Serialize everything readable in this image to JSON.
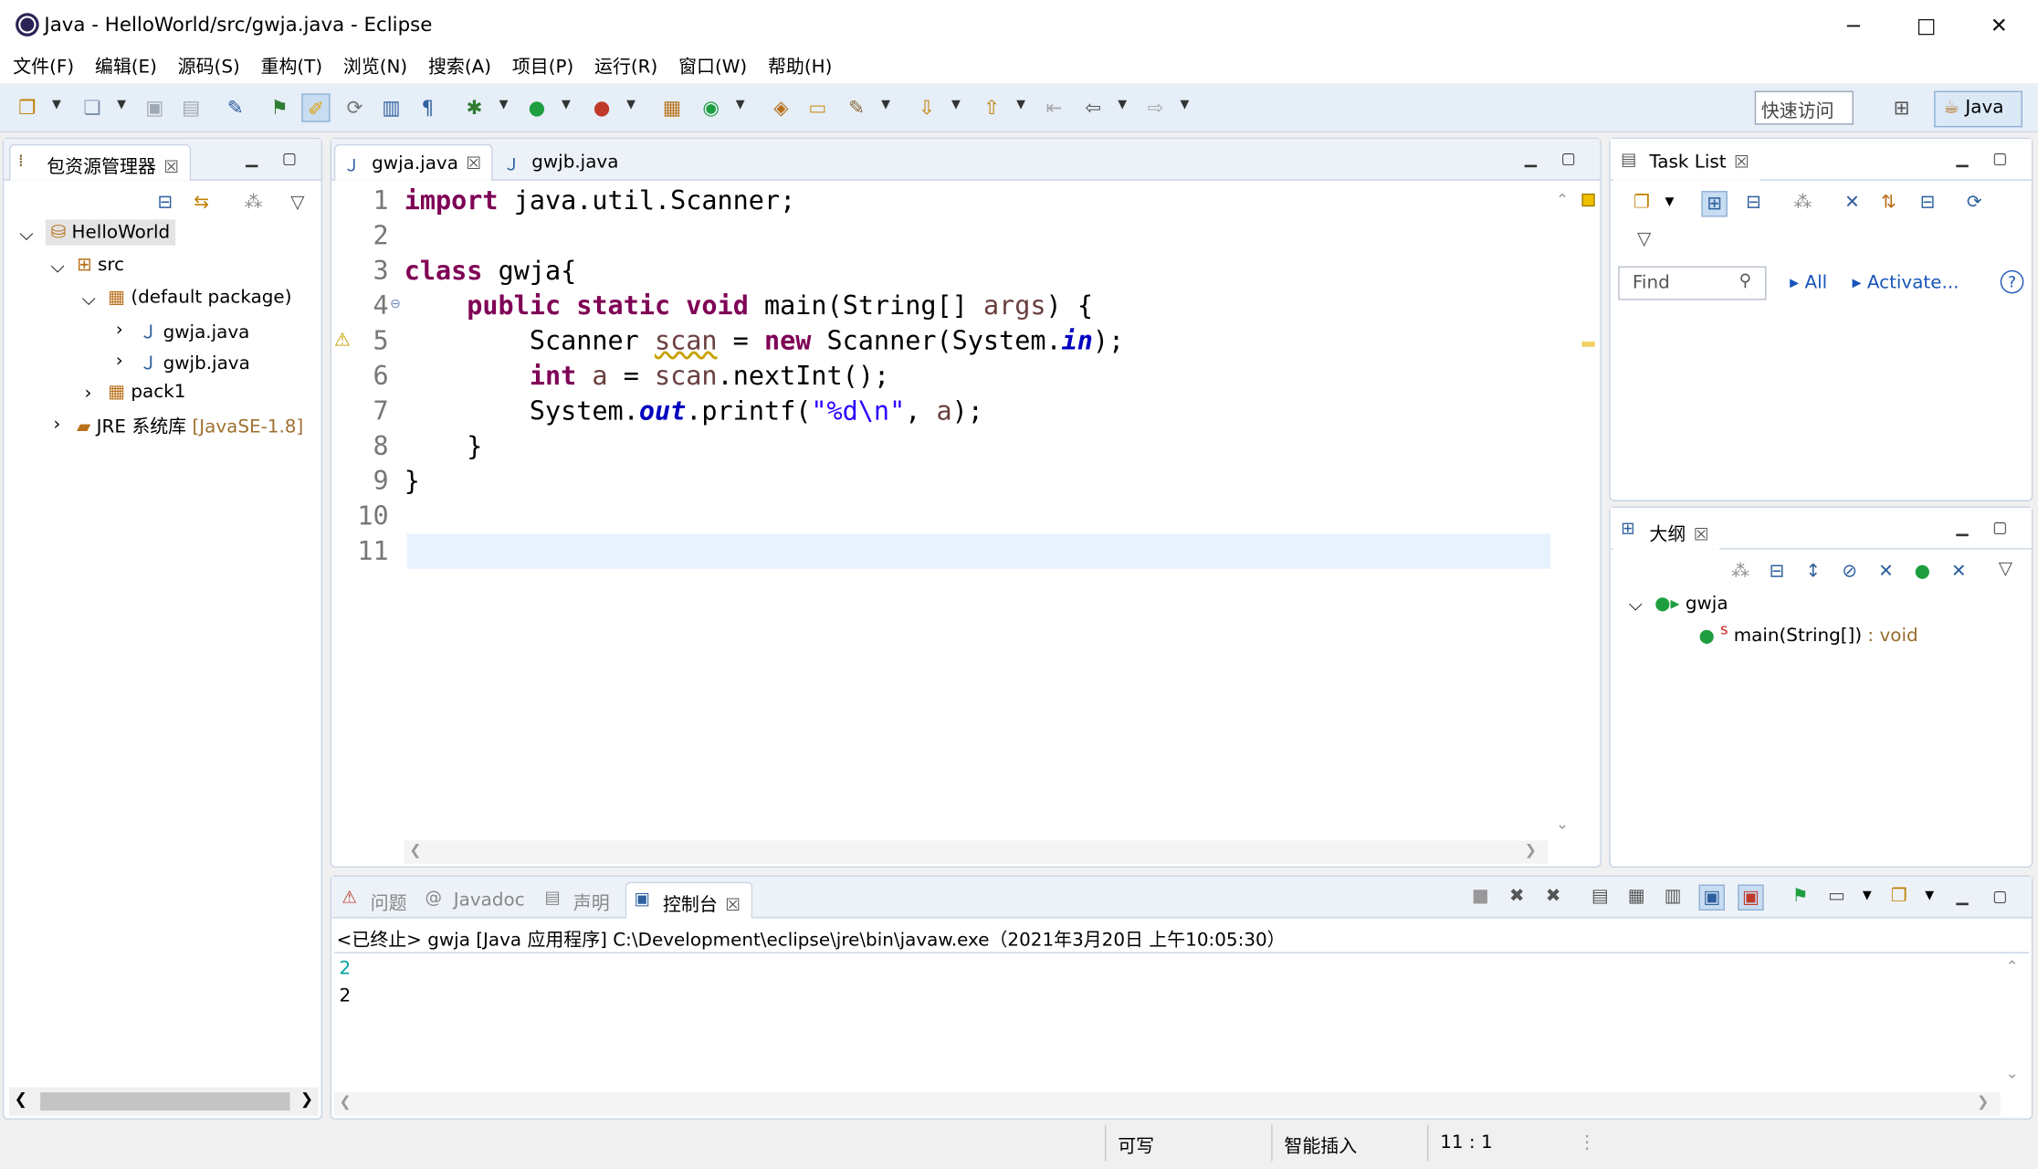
{
  "window": {
    "title": "Java  -  HelloWorld/src/gwja.java  -  Eclipse",
    "minimize": "−",
    "maximize": "□",
    "close": "✕"
  },
  "menu": [
    "文件(F)",
    "编辑(E)",
    "源码(S)",
    "重构(T)",
    "浏览(N)",
    "搜索(A)",
    "项目(P)",
    "运行(R)",
    "窗口(W)",
    "帮助(H)"
  ],
  "toolbar": {
    "quick_access": "快速访问",
    "perspective": "Java"
  },
  "package_explorer": {
    "tab_label": "包资源管理器",
    "tree": {
      "project": "HelloWorld",
      "src": "src",
      "default_package": "(default package)",
      "files": [
        "gwja.java",
        "gwjb.java"
      ],
      "pack1": "pack1",
      "jre": "JRE 系统库",
      "jre_version": "[JavaSE-1.8]"
    }
  },
  "editor": {
    "tabs": [
      "gwja.java",
      "gwjb.java"
    ],
    "line_numbers": [
      "1",
      "2",
      "3",
      "4",
      "5",
      "6",
      "7",
      "8",
      "9",
      "10",
      "11"
    ]
  },
  "task_list": {
    "tab_label": "Task List",
    "find_placeholder": "Find",
    "all": "All",
    "activate": "Activate..."
  },
  "outline": {
    "tab_label": "大纲",
    "class_name": "gwja",
    "method": "main(String[])",
    "return_type": " : void"
  },
  "console": {
    "tabs": [
      "问题",
      "Javadoc",
      "声明",
      "控制台"
    ],
    "header": "<已终止> gwja [Java 应用程序] C:\\Development\\eclipse\\jre\\bin\\javaw.exe（2021年3月20日 上午10:05:30）",
    "lines": [
      "2",
      "2"
    ]
  },
  "status": {
    "writable": "可写",
    "insert_mode": "智能插入",
    "position": "11 : 1"
  },
  "colors": {
    "keyword": "#7f0055",
    "string": "#2a00ff",
    "field": "#0000c0",
    "input_echo": "#00a0a0"
  }
}
